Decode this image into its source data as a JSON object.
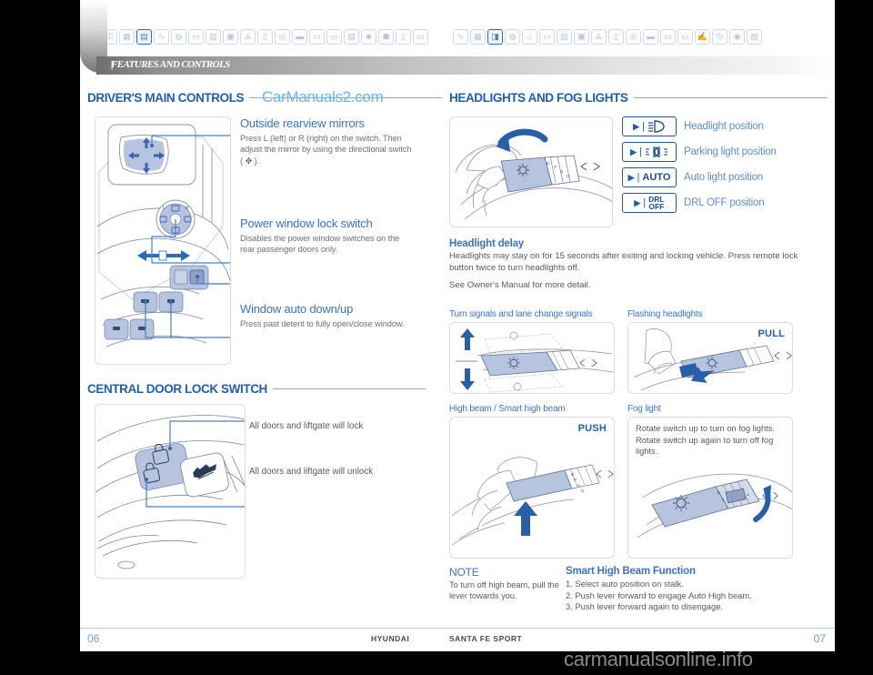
{
  "document": {
    "header_title": "FEATURES AND CONTROLS",
    "watermark_top": "CarManuals2.com",
    "watermark_bottom": "carmanualsonline.info",
    "brand": "HYUNDAI",
    "model": "SANTA FE SPORT",
    "page_left": "06",
    "page_right": "07"
  },
  "colors": {
    "heading_blue": "#1f5fa9",
    "label_blue": "#3e72b8",
    "body_gray": "#6d6f71",
    "accent_light_blue": "#63b7ea",
    "illustration_fill": "#b7c4e0"
  },
  "icon_strip": {
    "active_index": 2,
    "left_icons": [
      "key-icon",
      "dashboard-icon",
      "seat-controls-icon",
      "wiper-icon",
      "mirror-icon",
      "seat-icon",
      "console-icon",
      "sunroof-icon",
      "antenna-icon",
      "usb-icon",
      "steering-icon",
      "audio-icon",
      "screen-icon",
      "trunk-icon",
      "cargo-icon",
      "driver-icon",
      "child-seat-icon",
      "door-icon",
      "vehicle-icon"
    ],
    "right_icons": [
      "wiper-icon",
      "dashboard-icon",
      "lights-icon",
      "mirror-icon",
      "camera-icon",
      "seat-icon",
      "console-icon",
      "sunroof-icon",
      "antenna-icon",
      "usb-icon",
      "steering-icon",
      "audio-icon",
      "screen-icon",
      "trunk-icon",
      "brush-icon",
      "power-icon",
      "gauge-icon",
      "manual-icon"
    ]
  },
  "left_column": {
    "section1": {
      "title": "DRIVER'S MAIN CONTROLS",
      "callouts": [
        {
          "title": "Outside rearview mirrors",
          "body": "Press L (left) or R (right) on the switch. Then adjust the mirror by using the directional switch ( ✥ )."
        },
        {
          "title": "Power window lock switch",
          "body": "Disables the power window switches on the rear passenger doors only."
        },
        {
          "title": "Window auto down/up",
          "body": "Press past detent to fully open/close window."
        }
      ]
    },
    "section2": {
      "title": "CENTRAL DOOR LOCK SWITCH",
      "callouts": [
        {
          "text": "All doors and liftgate will lock"
        },
        {
          "text": "All doors and liftgate will unlock"
        }
      ]
    }
  },
  "right_column": {
    "section_title": "HEADLIGHTS AND FOG LIGHTS",
    "positions": [
      {
        "glyph": "headlight-symbol",
        "chip_text": "",
        "label": "Headlight position"
      },
      {
        "glyph": "parking-light-symbol",
        "chip_text": "",
        "label": "Parking light position"
      },
      {
        "glyph": "text",
        "chip_text": "AUTO",
        "label": "Auto light position"
      },
      {
        "glyph": "text-two-line",
        "chip_text": "DRL OFF",
        "chip_line1": "DRL",
        "chip_line2": "OFF",
        "label": "DRL OFF position"
      }
    ],
    "headlight_delay": {
      "title": "Headlight delay",
      "body1": "Headlights may stay on for 15 seconds after exiting and locking vehicle. Press remote lock button twice to turn headlights off.",
      "body2": "See Owner's Manual for more detail."
    },
    "panels": [
      {
        "caption": "Turn signals and lane change signals",
        "tag": ""
      },
      {
        "caption": "Flashing headlights",
        "tag": "PULL"
      },
      {
        "caption": "High beam / Smart high beam",
        "tag": "PUSH"
      },
      {
        "caption": "Fog light",
        "tag": "",
        "body": "Rotate switch up to turn on fog lights. Rotate switch up again to turn off fog lights."
      }
    ],
    "note": {
      "title": "NOTE",
      "body": "To turn off high beam, pull the lever towards you."
    },
    "smart_high_beam": {
      "title": "Smart High Beam Function",
      "steps": [
        "1. Select auto position on stalk.",
        "2. Push lever forward to engage Auto High beam.",
        "3. Push lever forward again to disengage."
      ]
    }
  }
}
